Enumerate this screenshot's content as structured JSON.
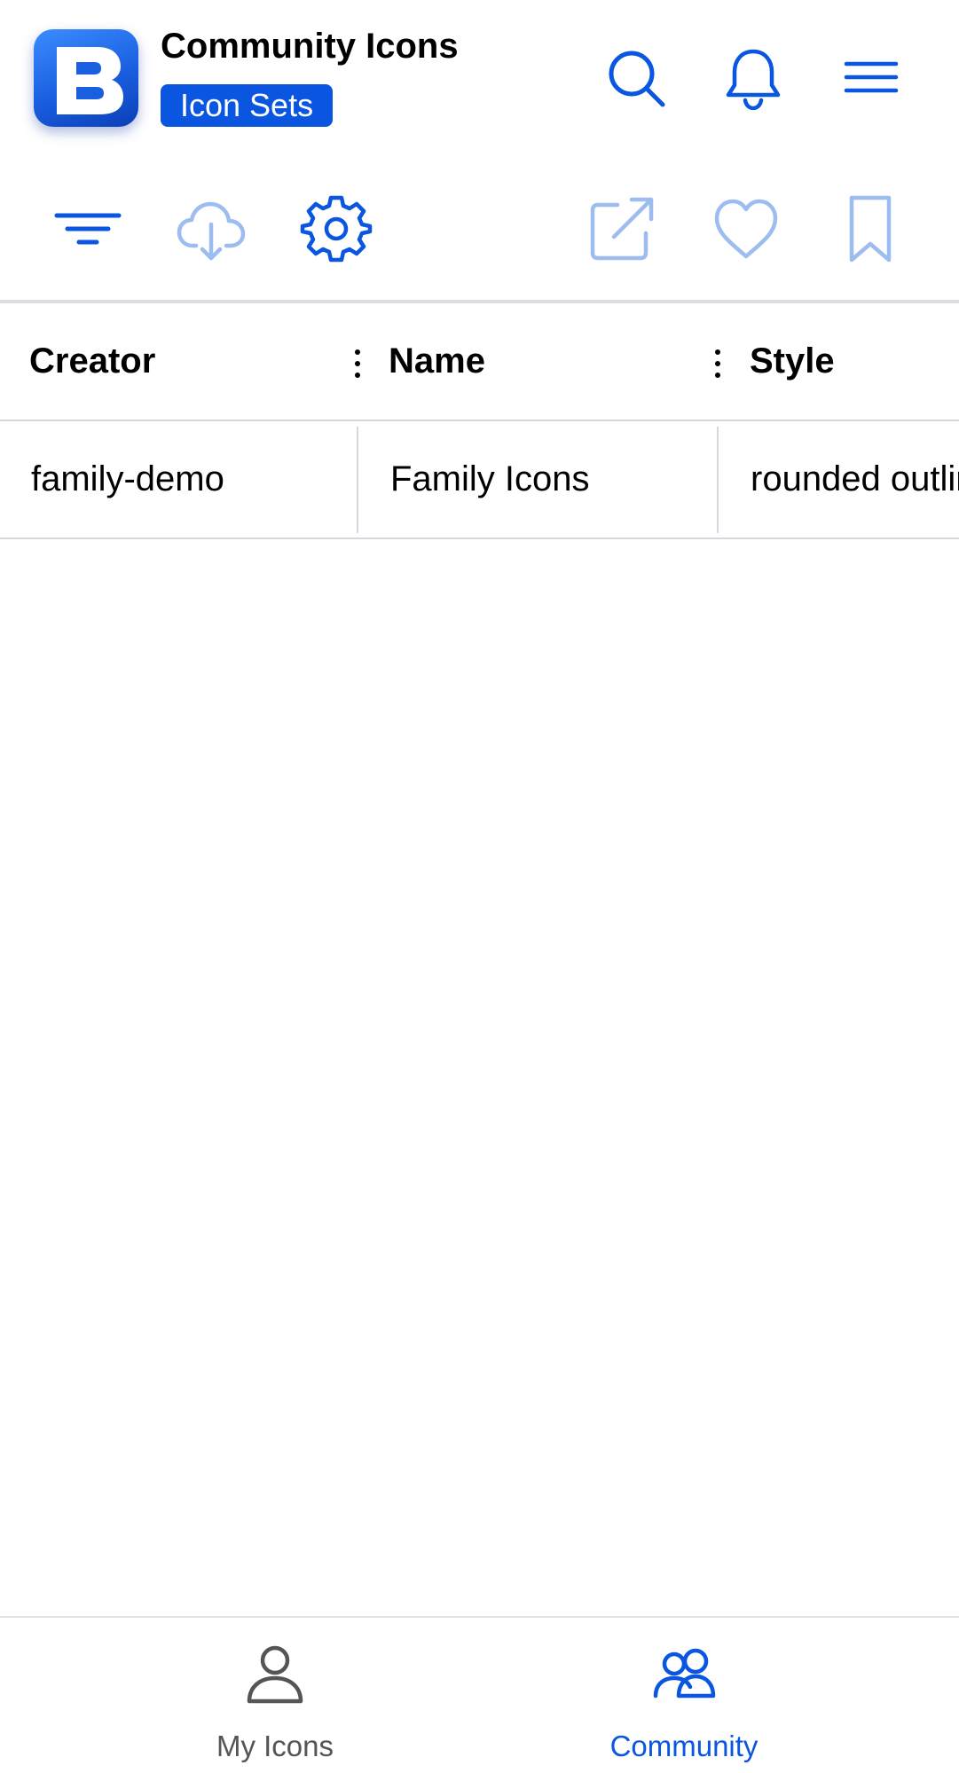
{
  "header": {
    "title": "Community Icons",
    "badge": "Icon Sets",
    "logo_icon": "app-logo-b",
    "actions": [
      {
        "name": "search",
        "icon": "search-icon"
      },
      {
        "name": "notifications",
        "icon": "bell-icon"
      },
      {
        "name": "menu",
        "icon": "hamburger-icon"
      }
    ]
  },
  "toolbar": {
    "left": [
      "filter-icon",
      "cloud-download-icon",
      "settings-gear-icon"
    ],
    "right": [
      "external-link-icon",
      "heart-icon",
      "bookmark-icon"
    ]
  },
  "table": {
    "columns": [
      "Creator",
      "Name",
      "Style"
    ],
    "rows": [
      {
        "creator": "family-demo",
        "name": "Family Icons",
        "style": "rounded outline"
      }
    ]
  },
  "bottom_nav": {
    "items": [
      {
        "label": "My Icons",
        "icon": "person-icon",
        "active": false
      },
      {
        "label": "Community",
        "icon": "people-icon",
        "active": true
      }
    ]
  },
  "colors": {
    "accent": "#0a56e0",
    "accent_light": "#9dbcf0",
    "divider": "#d6d8e0",
    "inactive_nav": "#555555"
  }
}
